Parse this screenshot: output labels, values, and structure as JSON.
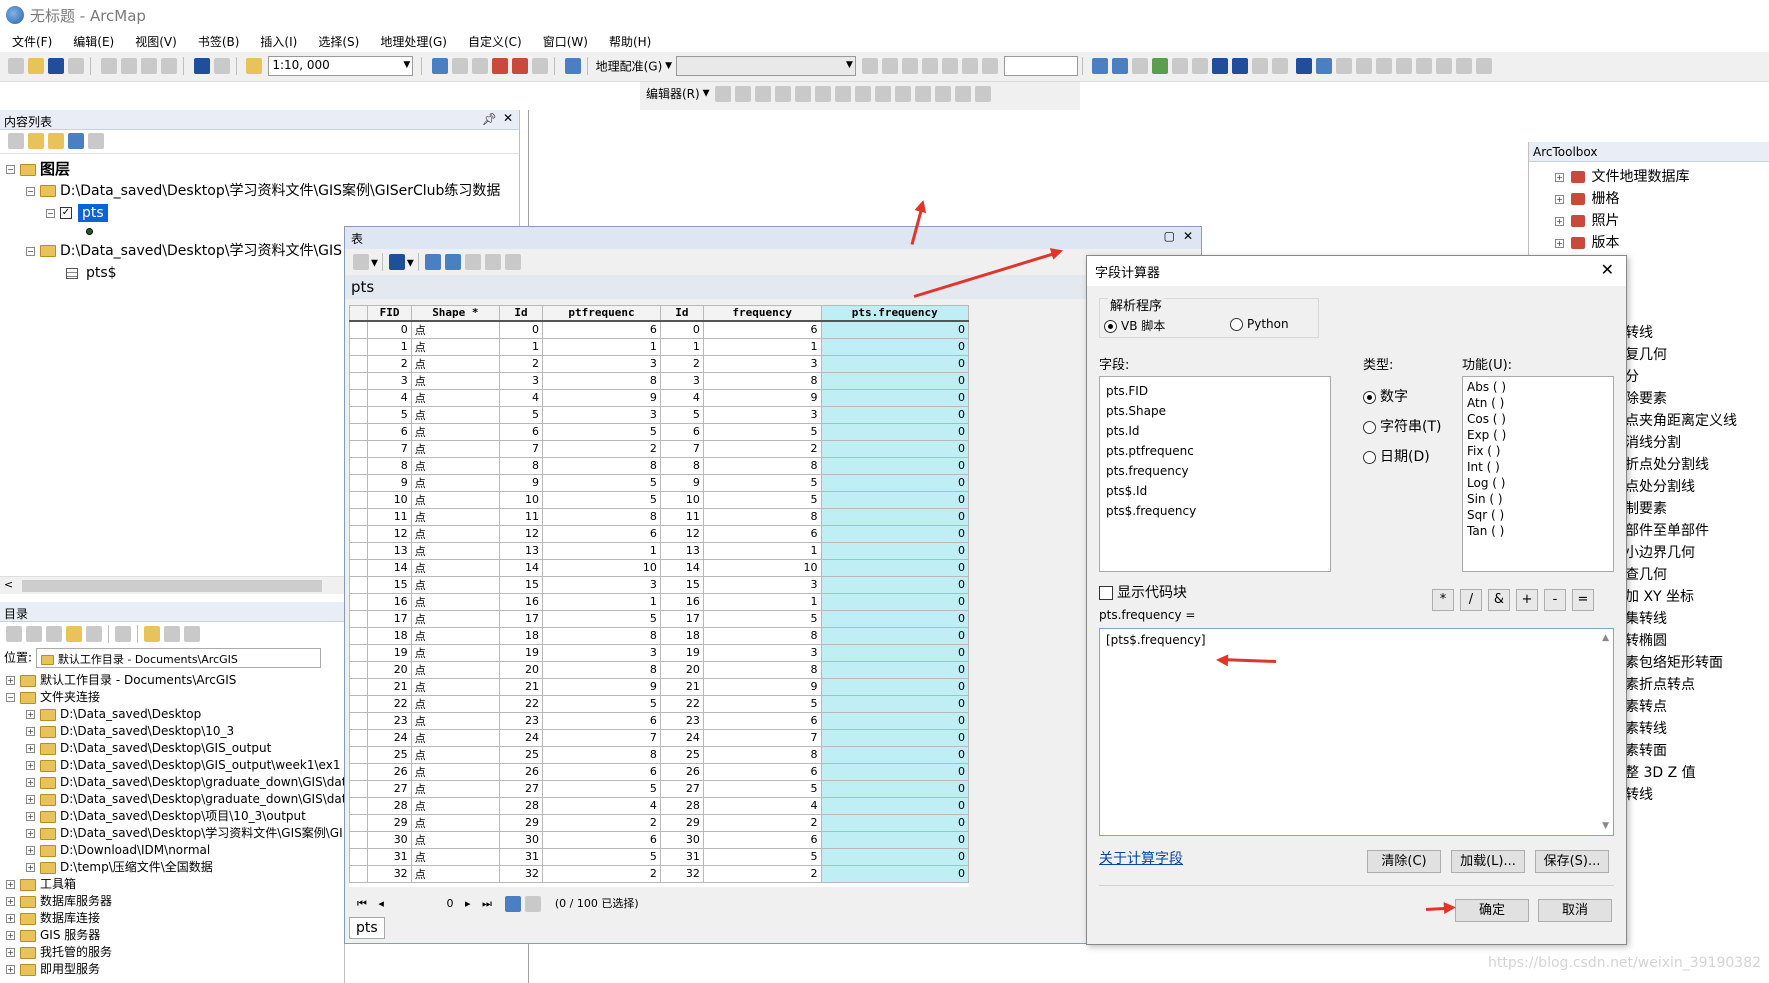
{
  "window": {
    "title": "无标题 - ArcMap"
  },
  "menu": [
    "文件(F)",
    "编辑(E)",
    "视图(V)",
    "书签(B)",
    "插入(I)",
    "选择(S)",
    "地理处理(G)",
    "自定义(C)",
    "窗口(W)",
    "帮助(H)"
  ],
  "toolbar": {
    "scale": "1:10, 000",
    "georef": "地理配准(G)",
    "editor": "编辑器(R)"
  },
  "toc": {
    "title": "内容列表",
    "root": "图层",
    "path1": "D:\\Data_saved\\Desktop\\学习资料文件\\GIS案例\\GISerClub练习数据",
    "layer_pts": "pts",
    "path2": "D:\\Data_saved\\Desktop\\学习资料文件\\GIS",
    "table_pts": "pts$"
  },
  "catalog": {
    "title": "目录",
    "location_label": "位置:",
    "location_value": "默认工作目录 - Documents\\ArcGIS",
    "items": [
      {
        "label": "默认工作目录 - Documents\\ArcGIS",
        "indent": 0
      },
      {
        "label": "文件夹连接",
        "indent": 0,
        "open": true
      },
      {
        "label": "D:\\Data_saved\\Desktop",
        "indent": 1
      },
      {
        "label": "D:\\Data_saved\\Desktop\\10_3",
        "indent": 1
      },
      {
        "label": "D:\\Data_saved\\Desktop\\GIS_output",
        "indent": 1
      },
      {
        "label": "D:\\Data_saved\\Desktop\\GIS_output\\week1\\ex1",
        "indent": 1
      },
      {
        "label": "D:\\Data_saved\\Desktop\\graduate_down\\GIS\\dat",
        "indent": 1
      },
      {
        "label": "D:\\Data_saved\\Desktop\\graduate_down\\GIS\\dat",
        "indent": 1
      },
      {
        "label": "D:\\Data_saved\\Desktop\\项目\\10_3\\output",
        "indent": 1
      },
      {
        "label": "D:\\Data_saved\\Desktop\\学习资料文件\\GIS案例\\GI",
        "indent": 1
      },
      {
        "label": "D:\\Download\\IDM\\normal",
        "indent": 1
      },
      {
        "label": "D:\\temp\\压缩文件\\全国数据",
        "indent": 1
      },
      {
        "label": "工具箱",
        "indent": 0
      },
      {
        "label": "数据库服务器",
        "indent": 0
      },
      {
        "label": "数据库连接",
        "indent": 0
      },
      {
        "label": "GIS 服务器",
        "indent": 0
      },
      {
        "label": "我托管的服务",
        "indent": 0
      },
      {
        "label": "即用型服务",
        "indent": 0
      }
    ]
  },
  "table_window": {
    "title": "表",
    "layer": "pts",
    "tab": "pts",
    "nav_value": "0",
    "selection": "(0 / 100 已选择)",
    "columns": [
      "FID",
      "Shape *",
      "Id",
      "ptfrequenc",
      "Id",
      "frequency",
      "pts.frequency"
    ],
    "rows": [
      [
        "0",
        "点",
        "0",
        "6",
        "0",
        "6",
        "0"
      ],
      [
        "1",
        "点",
        "1",
        "1",
        "1",
        "1",
        "0"
      ],
      [
        "2",
        "点",
        "2",
        "3",
        "2",
        "3",
        "0"
      ],
      [
        "3",
        "点",
        "3",
        "8",
        "3",
        "8",
        "0"
      ],
      [
        "4",
        "点",
        "4",
        "9",
        "4",
        "9",
        "0"
      ],
      [
        "5",
        "点",
        "5",
        "3",
        "5",
        "3",
        "0"
      ],
      [
        "6",
        "点",
        "6",
        "5",
        "6",
        "5",
        "0"
      ],
      [
        "7",
        "点",
        "7",
        "2",
        "7",
        "2",
        "0"
      ],
      [
        "8",
        "点",
        "8",
        "8",
        "8",
        "8",
        "0"
      ],
      [
        "9",
        "点",
        "9",
        "5",
        "9",
        "5",
        "0"
      ],
      [
        "10",
        "点",
        "10",
        "5",
        "10",
        "5",
        "0"
      ],
      [
        "11",
        "点",
        "11",
        "8",
        "11",
        "8",
        "0"
      ],
      [
        "12",
        "点",
        "12",
        "6",
        "12",
        "6",
        "0"
      ],
      [
        "13",
        "点",
        "13",
        "1",
        "13",
        "1",
        "0"
      ],
      [
        "14",
        "点",
        "14",
        "10",
        "14",
        "10",
        "0"
      ],
      [
        "15",
        "点",
        "15",
        "3",
        "15",
        "3",
        "0"
      ],
      [
        "16",
        "点",
        "16",
        "1",
        "16",
        "1",
        "0"
      ],
      [
        "17",
        "点",
        "17",
        "5",
        "17",
        "5",
        "0"
      ],
      [
        "18",
        "点",
        "18",
        "8",
        "18",
        "8",
        "0"
      ],
      [
        "19",
        "点",
        "19",
        "3",
        "19",
        "3",
        "0"
      ],
      [
        "20",
        "点",
        "20",
        "8",
        "20",
        "8",
        "0"
      ],
      [
        "21",
        "点",
        "21",
        "9",
        "21",
        "9",
        "0"
      ],
      [
        "22",
        "点",
        "22",
        "5",
        "22",
        "5",
        "0"
      ],
      [
        "23",
        "点",
        "23",
        "6",
        "23",
        "6",
        "0"
      ],
      [
        "24",
        "点",
        "24",
        "7",
        "24",
        "7",
        "0"
      ],
      [
        "25",
        "点",
        "25",
        "8",
        "25",
        "8",
        "0"
      ],
      [
        "26",
        "点",
        "26",
        "6",
        "26",
        "6",
        "0"
      ],
      [
        "27",
        "点",
        "27",
        "5",
        "27",
        "5",
        "0"
      ],
      [
        "28",
        "点",
        "28",
        "4",
        "28",
        "4",
        "0"
      ],
      [
        "29",
        "点",
        "29",
        "2",
        "29",
        "2",
        "0"
      ],
      [
        "30",
        "点",
        "30",
        "6",
        "30",
        "6",
        "0"
      ],
      [
        "31",
        "点",
        "31",
        "5",
        "31",
        "5",
        "0"
      ],
      [
        "32",
        "点",
        "32",
        "2",
        "32",
        "2",
        "0"
      ]
    ]
  },
  "field_calc": {
    "title": "字段计算器",
    "parser_label": "解析程序",
    "vb": "VB 脚本",
    "python": "Python",
    "fields_label": "字段:",
    "fields": [
      "pts.FID",
      "pts.Shape",
      "pts.Id",
      "pts.ptfrequenc",
      "pts.frequency",
      "pts$.Id",
      "pts$.frequency"
    ],
    "type_label": "类型:",
    "types": [
      "数字",
      "字符串(T)",
      "日期(D)"
    ],
    "functions_label": "功能(U):",
    "functions": [
      "Abs ( )",
      "Atn ( )",
      "Cos ( )",
      "Exp ( )",
      "Fix ( )",
      "Int ( )",
      "Log ( )",
      "Sin ( )",
      "Sqr ( )",
      "Tan ( )"
    ],
    "show_code": "显示代码块",
    "expr_label": "pts.frequency =",
    "expression": "[pts$.frequency]",
    "ops": [
      "*",
      "/",
      "&",
      "+",
      "-",
      "="
    ],
    "about": "关于计算字段",
    "clear": "清除(C)",
    "load": "加载(L)...",
    "save": "保存(S)...",
    "ok": "确定",
    "cancel": "取消"
  },
  "arctoolbox": {
    "title": "ArcToolbox",
    "items": [
      "文件地理数据库",
      "栅格",
      "照片",
      "版本"
    ],
    "partial": [
      "转线",
      "复几何",
      "分",
      "除要素",
      "点夹角距离定义线",
      "消线分割",
      "折点处分割线",
      "点处分割线",
      "制要素",
      "部件至单部件",
      "小边界几何",
      "查几何",
      "加 XY 坐标",
      "集转线",
      "转椭圆",
      "素包络矩形转面",
      "素折点转点",
      "素转点",
      "素转线",
      "素转面",
      "整 3D Z 值",
      "转线"
    ]
  },
  "watermark": "https://blog.csdn.net/weixin_39190382"
}
